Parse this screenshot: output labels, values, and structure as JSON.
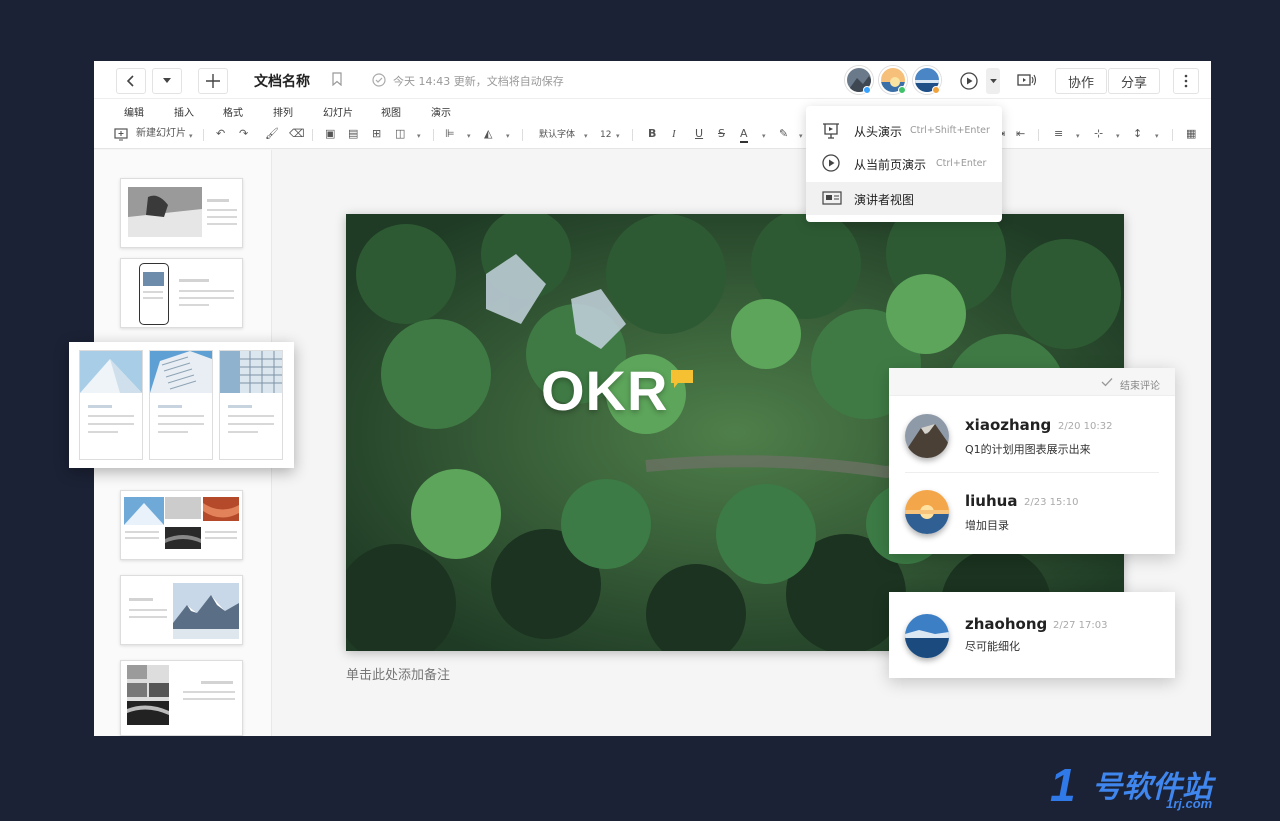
{
  "titlebar": {
    "doc_title": "文档名称",
    "save_status": "今天 14:43 更新，文档将自动保存",
    "collaborate_label": "协作",
    "share_label": "分享"
  },
  "menu": [
    "编辑",
    "插入",
    "格式",
    "排列",
    "幻灯片",
    "视图",
    "演示"
  ],
  "toolbar": {
    "new_slide_label": "新建幻灯片",
    "font_family": "默认字体",
    "font_size": "12"
  },
  "present_menu": [
    {
      "label": "从头演示",
      "shortcut": "Ctrl+Shift+Enter"
    },
    {
      "label": "从当前页演示",
      "shortcut": "Ctrl+Enter"
    },
    {
      "label": "演讲者视图",
      "shortcut": ""
    }
  ],
  "slide": {
    "title": "OKR",
    "notes_placeholder": "单击此处添加备注"
  },
  "comments": {
    "end_label": "结束评论",
    "items": [
      {
        "user": "xiaozhang",
        "time": "2/20 10:32",
        "text": "Q1的计划用图表展示出来"
      },
      {
        "user": "liuhua",
        "time": "2/23 15:10",
        "text": "增加目录"
      },
      {
        "user": "zhaohong",
        "time": "2/27 17:03",
        "text": "尽可能细化"
      }
    ]
  },
  "colors": {
    "background": "#1b2235",
    "accent": "#2f79e8",
    "comment_marker": "#f5c132"
  },
  "watermark": {
    "digit": "1",
    "text": "号软件站",
    "sub": "1rj.com"
  }
}
